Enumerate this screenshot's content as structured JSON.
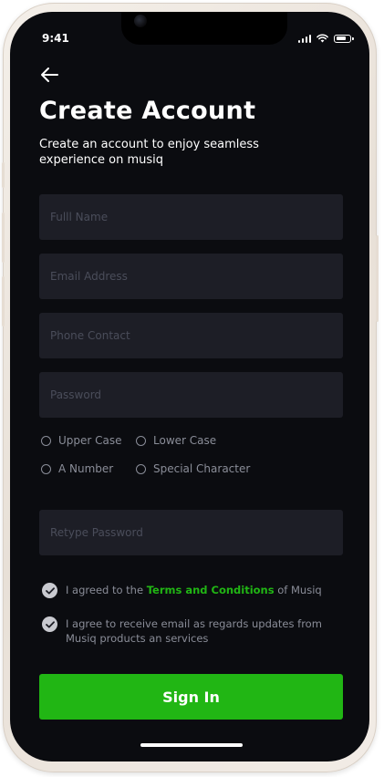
{
  "status_bar": {
    "time": "9:41"
  },
  "header": {
    "title": "Create Account",
    "subtitle": "Create an account to enjoy seamless experience on musiq"
  },
  "fields": {
    "full_name": {
      "placeholder": "Fulll Name",
      "value": ""
    },
    "email": {
      "placeholder": "Email Address",
      "value": ""
    },
    "phone": {
      "placeholder": "Phone Contact",
      "value": ""
    },
    "password": {
      "placeholder": "Password",
      "value": ""
    },
    "retype_password": {
      "placeholder": "Retype Password",
      "value": ""
    }
  },
  "password_rules": {
    "upper_case": "Upper Case",
    "lower_case": "Lower Case",
    "number": "A Number",
    "special": "Special Character"
  },
  "agreements": {
    "terms_prefix": "I agreed to the",
    "terms_link": "Terms and Conditions",
    "terms_suffix": "of Musiq",
    "email_updates": "I agree to receive email as regards updates from Musiq products an services"
  },
  "actions": {
    "sign_in_label": "Sign In"
  },
  "colors": {
    "accent": "#21b614",
    "background": "#0b0c10",
    "field_bg": "#1d1e26",
    "muted_text": "#8a8d98"
  },
  "icons": {
    "back": "arrow-left-icon",
    "check": "check-circle-icon",
    "radio": "radio-empty-icon"
  }
}
